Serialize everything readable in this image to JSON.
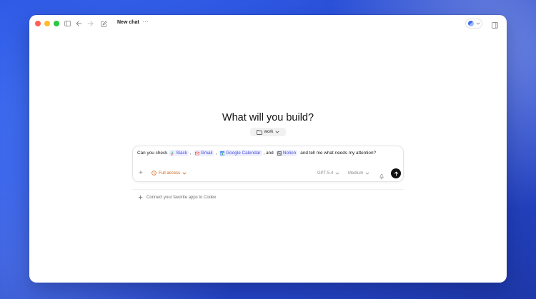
{
  "titlebar": {
    "title": "New chat",
    "more": "···"
  },
  "main": {
    "heading": "What will you build?",
    "folder": "work"
  },
  "composer": {
    "prompt_parts": {
      "p1": "Can you check",
      "slack": "Slack",
      "comma1": ",",
      "gmail": "Gmail",
      "comma2": ",",
      "gcal": "Google Calendar",
      "comma3": ", and",
      "notion": "Notion",
      "p2": "and tell me what needs my attention?"
    },
    "access_label": "Full access",
    "model_label": "GPT-5.4",
    "effort_label": "Medium"
  },
  "footer": {
    "connect_label": "Connect your favorite apps to Codex"
  },
  "colors": {
    "accent_access": "#d0641c",
    "chip_text": "#4a4fd8",
    "chip_bg": "#eef0ff"
  }
}
